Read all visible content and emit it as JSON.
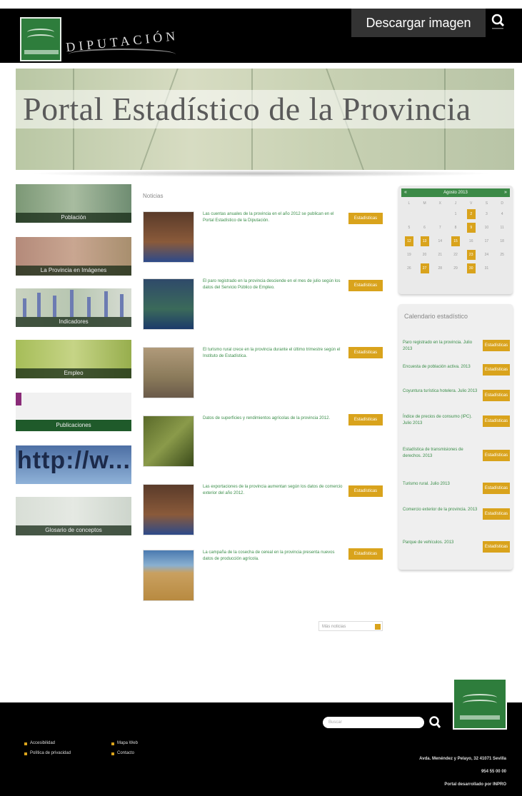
{
  "header": {
    "brand": "DIPUTACIÓN",
    "download_label": "Descargar imagen"
  },
  "banner": {
    "title": "Portal Estadístico de la Provincia"
  },
  "left_tiles": [
    {
      "caption": "Población"
    },
    {
      "caption": "La Provincia en Imágenes"
    },
    {
      "caption": "Indicadores"
    },
    {
      "caption": "Empleo"
    },
    {
      "caption": "Publicaciones"
    },
    {
      "caption": "http://w..."
    },
    {
      "caption": "Glosario de conceptos"
    }
  ],
  "news": {
    "label": "Noticias",
    "items": [
      {
        "text": "Las cuentas anuales de la provincia en el año 2012 se publican en el Portal Estadístico de la Diputación.",
        "badge": "Estadísticas"
      },
      {
        "text": "El paro registrado en la provincia desciende en el mes de julio según los datos del Servicio Público de Empleo.",
        "badge": "Estadísticas"
      },
      {
        "text": "El turismo rural crece en la provincia durante el último trimestre según el Instituto de Estadística.",
        "badge": "Estadísticas"
      },
      {
        "text": "Datos de superficies y rendimientos agrícolas de la provincia 2012.",
        "badge": "Estadísticas"
      },
      {
        "text": "Las exportaciones de la provincia aumentan según los datos de comercio exterior del año 2012.",
        "badge": "Estadísticas"
      },
      {
        "text": "La campaña de la cosecha de cereal en la provincia presenta nuevos datos de producción agrícola.",
        "badge": "Estadísticas"
      }
    ],
    "more_label": "Más noticias"
  },
  "calendar": {
    "month": "Agosto 2013",
    "prev": "«",
    "next": "»",
    "dow": [
      "L",
      "M",
      "X",
      "J",
      "V",
      "S",
      "D"
    ],
    "days": [
      "",
      "",
      "",
      "1",
      "2",
      "3",
      "4",
      "5",
      "6",
      "7",
      "8",
      "9",
      "10",
      "11",
      "12",
      "13",
      "14",
      "15",
      "16",
      "17",
      "18",
      "19",
      "20",
      "21",
      "22",
      "23",
      "24",
      "25",
      "26",
      "27",
      "28",
      "29",
      "30",
      "31",
      ""
    ],
    "highlighted": [
      "2",
      "9",
      "12",
      "13",
      "15",
      "23",
      "27",
      "30"
    ]
  },
  "stats_calendar": {
    "title": "Calendario estadístico",
    "items": [
      {
        "text": "Paro registrado en la provincia. Julio 2013",
        "badge": "Estadísticas"
      },
      {
        "text": "Encuesta de población activa. 2013",
        "badge": "Estadísticas"
      },
      {
        "text": "Coyuntura turística hotelera. Julio 2013",
        "badge": "Estadísticas"
      },
      {
        "text": "Índice de precios de consumo (IPC). Julio 2013",
        "badge": "Estadísticas"
      },
      {
        "text": "Estadística de transmisiones de derechos. 2013",
        "badge": "Estadísticas"
      },
      {
        "text": "Turismo rural. Julio 2013",
        "badge": "Estadísticas"
      },
      {
        "text": "Comercio exterior de la provincia. 2013",
        "badge": "Estadísticas"
      },
      {
        "text": "Parque de vehículos. 2013",
        "badge": "Estadísticas"
      }
    ]
  },
  "footer": {
    "search_placeholder": "Buscar",
    "links": [
      "Accesibilidad",
      "Mapa Web",
      "Política de privacidad",
      "Contacto"
    ],
    "address": "Avda. Menéndez y Pelayo, 32 41071 Sevilla",
    "phone": "954 55 00 00",
    "copyright": "Portal desarrollado por INPRO"
  }
}
